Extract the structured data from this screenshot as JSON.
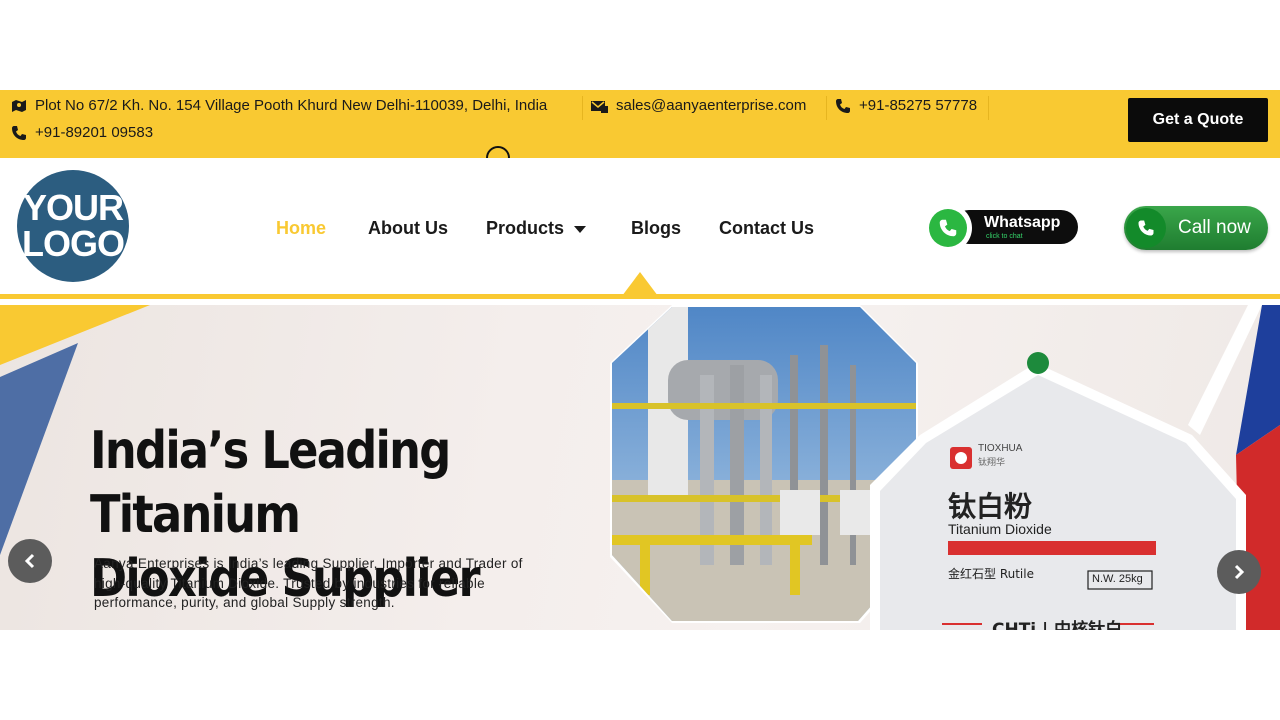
{
  "topbar": {
    "address": "Plot No 67/2 Kh. No. 154 Village Pooth Khurd New Delhi-110039, Delhi, India",
    "email": "sales@aanyaenterprise.com",
    "phone1": "+91-85275 57778",
    "phone2": "+91-89201 09583",
    "quote_label": "Get a Quote"
  },
  "logo": {
    "line1": "YOUR",
    "line2": "LOGO"
  },
  "nav": {
    "items": [
      {
        "label": "Home",
        "active": true
      },
      {
        "label": "About Us"
      },
      {
        "label": "Products",
        "has_dropdown": true
      },
      {
        "label": "Blogs"
      },
      {
        "label": "Contact Us"
      }
    ]
  },
  "whatsapp": {
    "label": "Whatsapp",
    "sub": "click to chat"
  },
  "call": {
    "label": "Call now"
  },
  "hero": {
    "title_line1": "India’s Leading Titanium",
    "title_line2": "Dioxide Supplier",
    "description": "Aanya Enterprises is India’s leading Supplier, Importer and Trader of high-quality Titanium Dioxide. Trusted by industries for reliable performance, purity, and global Supply strength.",
    "bag": {
      "brand": "TIOXHUA",
      "brand_cn": "钛翔华",
      "title_cn": "钛白粉",
      "title_en": "Titanium Dioxide",
      "grade": "金红石型 Rutile",
      "weight": "N.W. 25kg",
      "maker": "CHTi | 中核钛白"
    }
  },
  "colors": {
    "accent": "#f9c932",
    "dark": "#0b0b0b",
    "logo_bg": "#2c5d80",
    "call_green": "#2a9a3c"
  },
  "icons": [
    "map-icon",
    "email-icon",
    "phone-icon",
    "whatsapp-icon",
    "chevron-left-icon",
    "chevron-right-icon"
  ]
}
